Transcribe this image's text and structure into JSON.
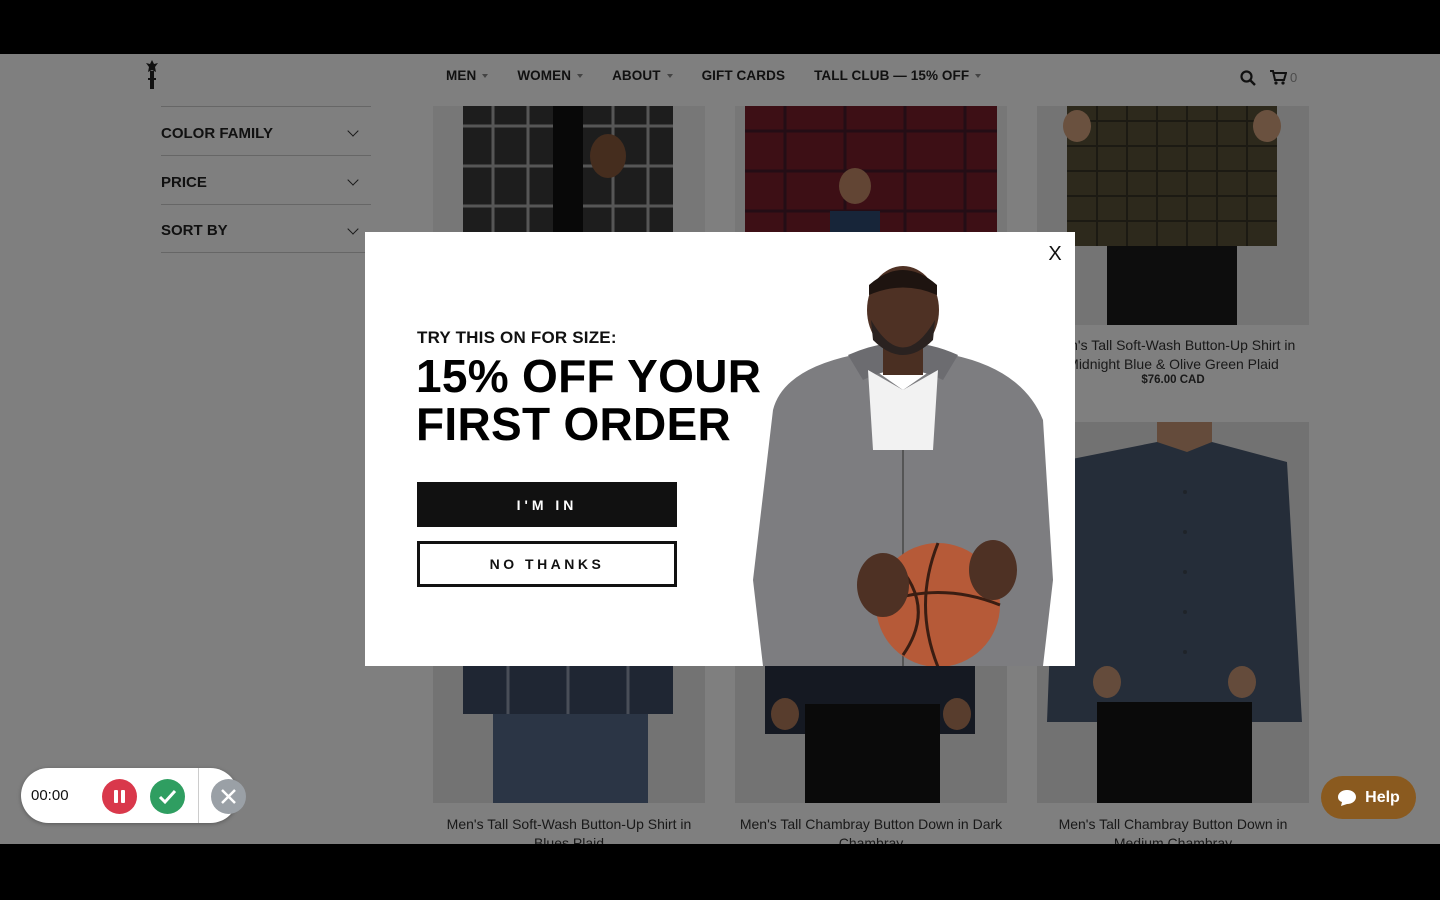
{
  "nav": {
    "items": [
      {
        "label": "MEN",
        "dropdown": true
      },
      {
        "label": "WOMEN",
        "dropdown": true
      },
      {
        "label": "ABOUT",
        "dropdown": true
      },
      {
        "label": "GIFT CARDS",
        "dropdown": false
      },
      {
        "label": "TALL CLUB — 15% OFF",
        "dropdown": true
      }
    ],
    "cart_count": "0"
  },
  "filters": [
    "COLOR FAMILY",
    "PRICE",
    "SORT BY"
  ],
  "products": [
    {
      "title": "",
      "price": ""
    },
    {
      "title": "",
      "price": ""
    },
    {
      "title": "Men's Tall Soft-Wash Button-Up Shirt in Midnight Blue & Olive Green Plaid",
      "price": "$76.00 CAD"
    },
    {
      "title": "Men's Tall Soft-Wash Button-Up Shirt in Blues Plaid",
      "price": ""
    },
    {
      "title": "Men's Tall Chambray Button Down in Dark Chambray",
      "price": ""
    },
    {
      "title": "Men's Tall Chambray Button Down in Medium Chambray",
      "price": ""
    }
  ],
  "modal": {
    "eyebrow": "TRY THIS ON FOR SIZE:",
    "headline_line1": "15% OFF YOUR",
    "headline_line2": "FIRST ORDER",
    "cta_primary": "I'M IN",
    "cta_secondary": "NO THANKS",
    "close_label": "X"
  },
  "recorder": {
    "time": "00:00"
  },
  "help": {
    "label": "Help"
  },
  "colors": {
    "overlay": "#000000",
    "help_bg": "#8a5a1f",
    "rec_pause": "#d9384b",
    "rec_done": "#2f9e61"
  }
}
